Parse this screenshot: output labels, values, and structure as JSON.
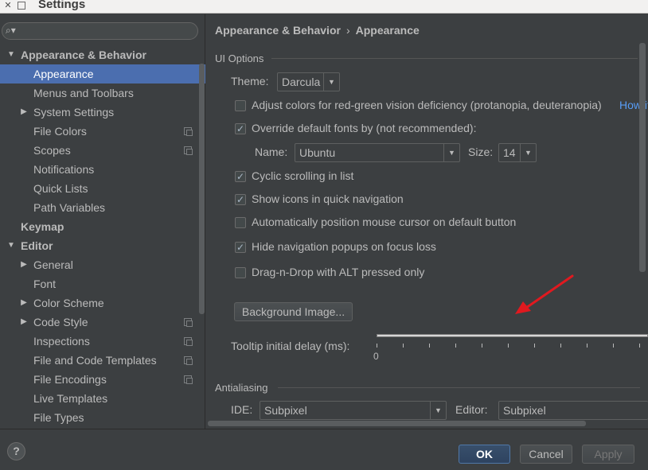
{
  "window": {
    "title": "Settings"
  },
  "sidebar": {
    "search_placeholder": "",
    "items": [
      {
        "label": "Appearance & Behavior",
        "level": 0,
        "bold": true,
        "expanded": true,
        "has_arrow": true
      },
      {
        "label": "Appearance",
        "level": 1,
        "selected": true
      },
      {
        "label": "Menus and Toolbars",
        "level": 1
      },
      {
        "label": "System Settings",
        "level": 1,
        "has_arrow": true,
        "expanded": false
      },
      {
        "label": "File Colors",
        "level": 1,
        "project_icon": true
      },
      {
        "label": "Scopes",
        "level": 1,
        "project_icon": true
      },
      {
        "label": "Notifications",
        "level": 1
      },
      {
        "label": "Quick Lists",
        "level": 1
      },
      {
        "label": "Path Variables",
        "level": 1
      },
      {
        "label": "Keymap",
        "level": 0,
        "bold": true
      },
      {
        "label": "Editor",
        "level": 0,
        "bold": true,
        "expanded": true,
        "has_arrow": true
      },
      {
        "label": "General",
        "level": 1,
        "has_arrow": true,
        "expanded": false
      },
      {
        "label": "Font",
        "level": 1
      },
      {
        "label": "Color Scheme",
        "level": 1,
        "has_arrow": true,
        "expanded": false
      },
      {
        "label": "Code Style",
        "level": 1,
        "has_arrow": true,
        "expanded": false,
        "project_icon": true
      },
      {
        "label": "Inspections",
        "level": 1,
        "project_icon": true
      },
      {
        "label": "File and Code Templates",
        "level": 1,
        "project_icon": true
      },
      {
        "label": "File Encodings",
        "level": 1,
        "project_icon": true
      },
      {
        "label": "Live Templates",
        "level": 1
      },
      {
        "label": "File Types",
        "level": 1
      }
    ]
  },
  "breadcrumb": {
    "parent": "Appearance & Behavior",
    "separator": "›",
    "current": "Appearance"
  },
  "ui_options": {
    "section_title": "UI Options",
    "theme_label": "Theme:",
    "theme_value": "Darcula",
    "checkboxes": [
      {
        "label": "Adjust colors for red-green vision deficiency (protanopia, deuteranopia)",
        "checked": false
      },
      {
        "label": "Override default fonts by (not recommended):",
        "checked": true
      },
      {
        "label": "Cyclic scrolling in list",
        "checked": true
      },
      {
        "label": "Show icons in quick navigation",
        "checked": true
      },
      {
        "label": "Automatically position mouse cursor on default button",
        "checked": false
      },
      {
        "label": "Hide navigation popups on focus loss",
        "checked": true
      },
      {
        "label": "Drag-n-Drop with ALT pressed only",
        "checked": false
      }
    ],
    "how_link": "How it",
    "font_name_label": "Name:",
    "font_name_value": "Ubuntu",
    "font_size_label": "Size:",
    "font_size_value": "14",
    "background_button": "Background Image...",
    "tooltip_label": "Tooltip initial delay (ms):",
    "tooltip_min": "0"
  },
  "antialiasing": {
    "section_title": "Antialiasing",
    "ide_label": "IDE:",
    "ide_value": "Subpixel",
    "editor_label": "Editor:",
    "editor_value": "Subpixel"
  },
  "footer": {
    "help": "?",
    "ok": "OK",
    "cancel": "Cancel",
    "apply": "Apply"
  },
  "colors": {
    "selection": "#4b6eaf",
    "background": "#3c3f41",
    "annotation_arrow": "#e0191f",
    "link": "#589df6"
  },
  "icons": {
    "tree_arrow_expanded": "triangle-down-icon",
    "tree_arrow_collapsed": "triangle-right-icon",
    "project_level": "copy-icon"
  }
}
